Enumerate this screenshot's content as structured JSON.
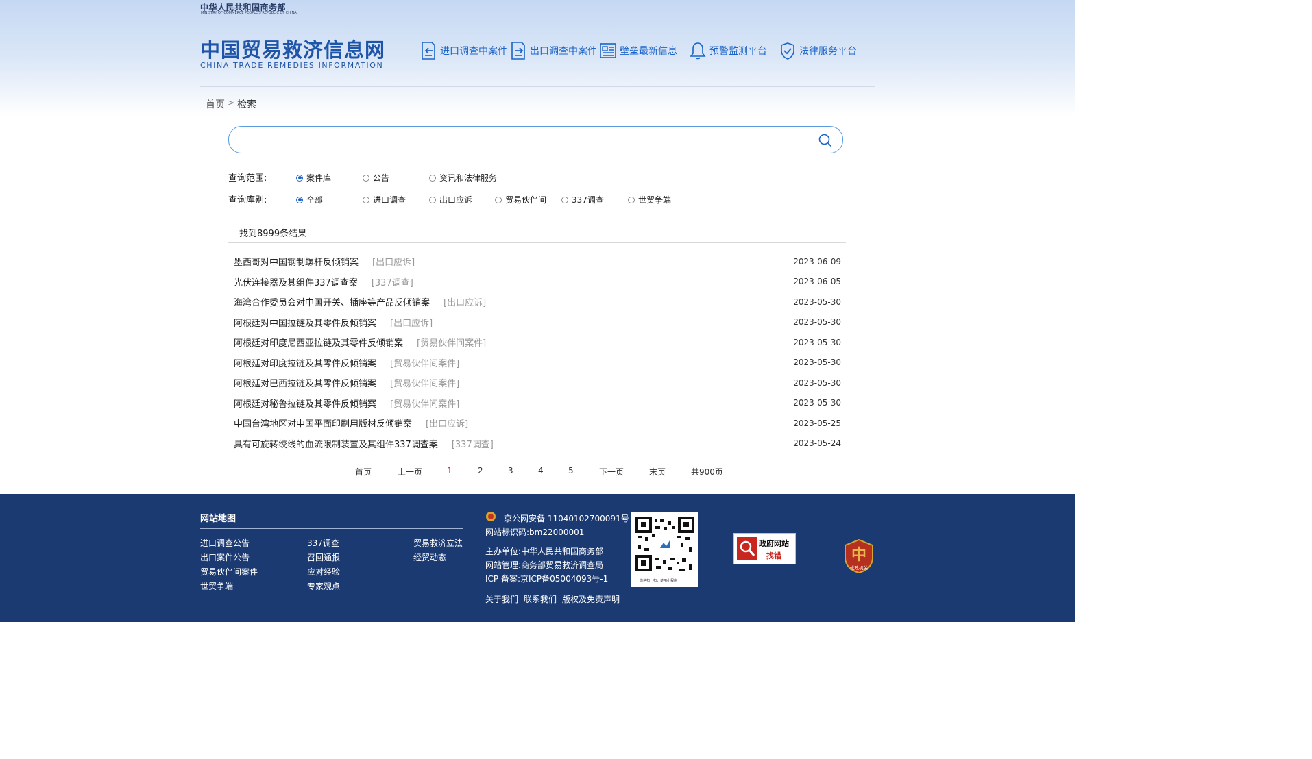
{
  "header": {
    "ministry_cn": "中华人民共和国商务部",
    "ministry_en": "MINISTRY OF COMMERCE PEOPLE'S REPUBLIC OF CHINA",
    "site_title": "中国贸易救济信息网",
    "site_subtitle": "CHINA TRADE REMEDIES INFORMATION",
    "nav": [
      {
        "label": "进口调查中案件",
        "icon": "import-case-icon"
      },
      {
        "label": "出口调查中案件",
        "icon": "export-case-icon"
      },
      {
        "label": "壁垒最新信息",
        "icon": "news-icon"
      },
      {
        "label": "预警监测平台",
        "icon": "bell-icon"
      },
      {
        "label": "法律服务平台",
        "icon": "shield-icon"
      }
    ]
  },
  "breadcrumb": {
    "home": "首页",
    "current": "检索"
  },
  "search": {
    "placeholder": "",
    "icon": "search-icon"
  },
  "filters": {
    "scope_label": "查询范围:",
    "scope_options": [
      "案件库",
      "公告",
      "资讯和法律服务"
    ],
    "scope_selected": 0,
    "category_label": "查询库别:",
    "category_options": [
      "全部",
      "进口调查",
      "出口应诉",
      "贸易伙伴间",
      "337调查",
      "世贸争端"
    ],
    "category_selected": 0
  },
  "results": {
    "count_text": "找到8999条结果",
    "items": [
      {
        "title": "墨西哥对中国钢制螺杆反倾销案",
        "tag": "[出口应诉]",
        "date": "2023-06-09"
      },
      {
        "title": "光伏连接器及其组件337调查案",
        "tag": "[337调查]",
        "date": "2023-06-05"
      },
      {
        "title": "海湾合作委员会对中国开关、插座等产品反倾销案",
        "tag": "[出口应诉]",
        "date": "2023-05-30"
      },
      {
        "title": "阿根廷对中国拉链及其零件反倾销案",
        "tag": "[出口应诉]",
        "date": "2023-05-30"
      },
      {
        "title": "阿根廷对印度尼西亚拉链及其零件反倾销案",
        "tag": "[贸易伙伴间案件]",
        "date": "2023-05-30"
      },
      {
        "title": "阿根廷对印度拉链及其零件反倾销案",
        "tag": "[贸易伙伴间案件]",
        "date": "2023-05-30"
      },
      {
        "title": "阿根廷对巴西拉链及其零件反倾销案",
        "tag": "[贸易伙伴间案件]",
        "date": "2023-05-30"
      },
      {
        "title": "阿根廷对秘鲁拉链及其零件反倾销案",
        "tag": "[贸易伙伴间案件]",
        "date": "2023-05-30"
      },
      {
        "title": "中国台湾地区对中国平面印刷用版材反倾销案",
        "tag": "[出口应诉]",
        "date": "2023-05-25"
      },
      {
        "title": "具有可旋转绞线的血流限制装置及其组件337调查案",
        "tag": "[337调查]",
        "date": "2023-05-24"
      }
    ]
  },
  "pagination": {
    "first": "首页",
    "prev": "上一页",
    "pages": [
      "1",
      "2",
      "3",
      "4",
      "5"
    ],
    "current": "1",
    "next": "下一页",
    "last": "末页",
    "total": "共900页"
  },
  "footer": {
    "sitemap_title": "网站地图",
    "col1": [
      "进口调查公告",
      "出口案件公告",
      "贸易伙伴间案件",
      "世贸争端"
    ],
    "col2": [
      "337调查",
      "召回通报",
      "应对经验",
      "专家观点"
    ],
    "col3": [
      "贸易救济立法",
      "经贸动态"
    ],
    "police_record": "京公网安备 11040102700091号",
    "site_id": "网站标识码:bm22000001",
    "sponsor": "主办单位:中华人民共和国商务部",
    "management": "网站管理:商务部贸易救济调查局",
    "icp": "ICP 备案:京ICP备05004093号-1",
    "bottom_links": [
      "关于我们",
      "联系我们",
      "版权及免责声明"
    ],
    "qr_caption": "微信扫一扫，使用小程序",
    "gov_badge_top": "政府网站",
    "gov_badge_bottom": "找错",
    "party_badge": "党政机关",
    "colors": {
      "footer_bg": "#1b3a72",
      "accent": "#1b64c8"
    }
  }
}
